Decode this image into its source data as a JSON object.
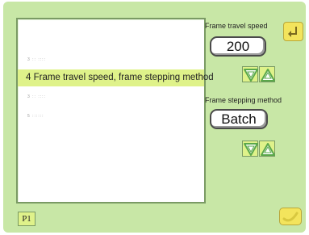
{
  "list": {
    "items": [
      {
        "text": "3 :: ::::"
      },
      {
        "text": "4 Frame travel speed, frame stepping method",
        "selected": true
      },
      {
        "text": "3 :: ::::"
      },
      {
        "text": "5 ::::::"
      }
    ]
  },
  "travel_speed": {
    "label": "Frame travel speed",
    "value": "200"
  },
  "stepping_method": {
    "label": "Frame stepping method",
    "value": "Batch"
  },
  "pager": {
    "page_label": "P1"
  },
  "icons": {
    "down": "down-arrow-icon",
    "up": "up-arrow-icon",
    "return": "return-icon",
    "confirm": "confirm-icon"
  },
  "colors": {
    "background": "#c8e7a6",
    "highlight": "#dff28a",
    "button_yellow": "#f3e45c",
    "arrow_green": "#5aa84a"
  }
}
